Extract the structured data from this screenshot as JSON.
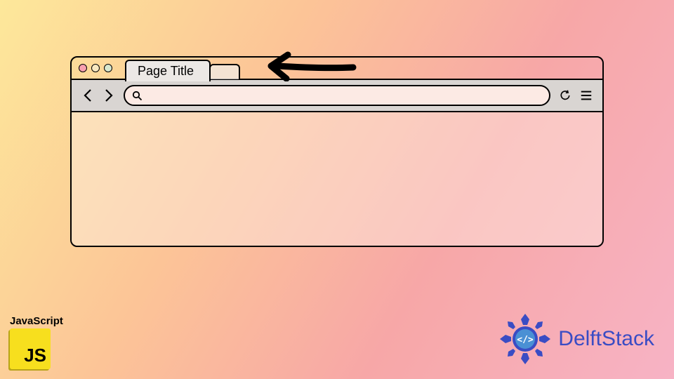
{
  "browser": {
    "tab_title": "Page Title",
    "address_value": ""
  },
  "logos": {
    "javascript_label": "JavaScript",
    "javascript_badge": "JS",
    "brand_name": "DelftStack"
  },
  "icons": {
    "close": "close",
    "minimize": "minimize",
    "maximize": "maximize",
    "back": "back",
    "forward": "forward",
    "search": "search",
    "refresh": "refresh",
    "menu": "menu"
  }
}
